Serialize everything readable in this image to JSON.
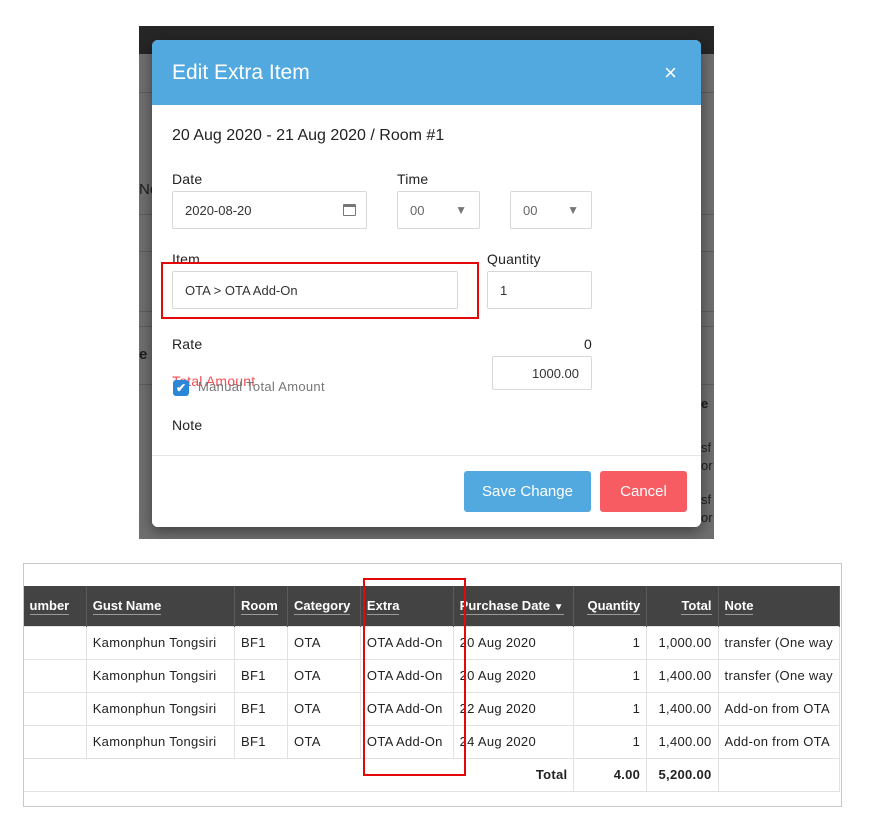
{
  "background": {
    "partial_text_1": "No",
    "partial_text_2": "e",
    "partial_text_3": "e",
    "partial_text_4": "sf",
    "partial_text_5": "or",
    "partial_text_6": "sf",
    "partial_text_7": "or"
  },
  "modal": {
    "title": "Edit Extra Item",
    "close_icon": "×",
    "subtitle": "20 Aug 2020 - 21 Aug 2020 / Room #1",
    "date_label": "Date",
    "date_value": "2020-08-20",
    "time_label": "Time",
    "hour_value": "00",
    "minute_value": "00",
    "item_label": "Item",
    "item_value": "OTA > OTA Add-On",
    "quantity_label": "Quantity",
    "quantity_value": "1",
    "rate_label": "Rate",
    "rate_value": "0",
    "total_amount_label": "Total Amount",
    "total_amount_value": "1000.00",
    "manual_total_label": "Manual Total Amount",
    "manual_total_checked": true,
    "note_label": "Note",
    "save_label": "Save Change",
    "cancel_label": "Cancel",
    "colors": {
      "header": "#52a9e0",
      "save": "#52a9e0",
      "cancel": "#f65c62",
      "total_label": "#f24d55"
    }
  },
  "table": {
    "columns": [
      {
        "label": "umber"
      },
      {
        "label": "Gust Name"
      },
      {
        "label": "Room"
      },
      {
        "label": "Category"
      },
      {
        "label": "Extra"
      },
      {
        "label": "Purchase Date",
        "sort": "desc"
      },
      {
        "label": "Quantity"
      },
      {
        "label": "Total"
      },
      {
        "label": "Note"
      }
    ],
    "rows": [
      {
        "number": "",
        "guest": "Kamonphun Tongsiri",
        "room": "BF1",
        "category": "OTA",
        "extra": "OTA Add-On",
        "date": "20 Aug 2020",
        "quantity": "1",
        "total": "1,000.00",
        "note": "transfer (One way"
      },
      {
        "number": "",
        "guest": "Kamonphun Tongsiri",
        "room": "BF1",
        "category": "OTA",
        "extra": "OTA Add-On",
        "date": "20 Aug 2020",
        "quantity": "1",
        "total": "1,400.00",
        "note": "transfer (One way"
      },
      {
        "number": "",
        "guest": "Kamonphun Tongsiri",
        "room": "BF1",
        "category": "OTA",
        "extra": "OTA Add-On",
        "date": "22 Aug 2020",
        "quantity": "1",
        "total": "1,400.00",
        "note": "Add-on from OTA"
      },
      {
        "number": "",
        "guest": "Kamonphun Tongsiri",
        "room": "BF1",
        "category": "OTA",
        "extra": "OTA Add-On",
        "date": "24 Aug 2020",
        "quantity": "1",
        "total": "1,400.00",
        "note": "Add-on from OTA"
      }
    ],
    "total_label": "Total",
    "total_quantity": "4.00",
    "total_amount": "5,200.00"
  }
}
